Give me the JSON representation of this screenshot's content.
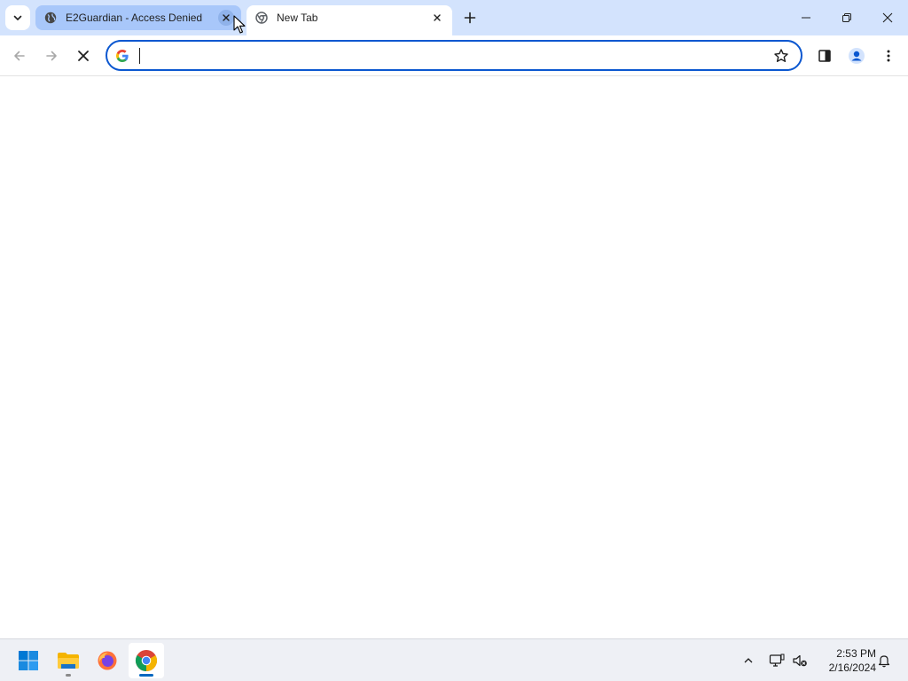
{
  "browser": {
    "tabs": [
      {
        "title": "E2Guardian - Access Denied",
        "active": false,
        "favicon": "globe-icon"
      },
      {
        "title": "New Tab",
        "active": true,
        "favicon": "chrome-icon"
      }
    ],
    "tab_search_icon": "chevron-down-icon",
    "new_tab_icon": "plus-icon",
    "window_controls": [
      "minimize-icon",
      "restore-icon",
      "close-icon"
    ]
  },
  "toolbar": {
    "back_icon": "arrow-left-icon",
    "forward_icon": "arrow-right-icon",
    "stop_icon": "close-icon",
    "omnibox": {
      "value": "",
      "placeholder": "",
      "engine_icon": "google-g-icon"
    },
    "bookmark_icon": "star-icon",
    "side_panel_icon": "side-panel-icon",
    "profile_icon": "profile-icon",
    "menu_icon": "kebab-menu-icon"
  },
  "taskbar": {
    "apps": [
      {
        "name": "Start",
        "icon": "windows-icon"
      },
      {
        "name": "File Explorer",
        "icon": "folder-icon"
      },
      {
        "name": "Firefox",
        "icon": "firefox-icon"
      },
      {
        "name": "Google Chrome",
        "icon": "chrome-icon"
      }
    ],
    "tray_icons": [
      "chevron-up-icon",
      "network-icon",
      "volume-muted-icon"
    ],
    "time": "2:53 PM",
    "date": "2/16/2024",
    "notification_icon": "bell-icon"
  },
  "colors": {
    "tabstrip": "#d3e3fd",
    "inactive_tab": "#a8c7fa",
    "accent": "#0b57d0",
    "taskbar": "#eef0f5"
  }
}
